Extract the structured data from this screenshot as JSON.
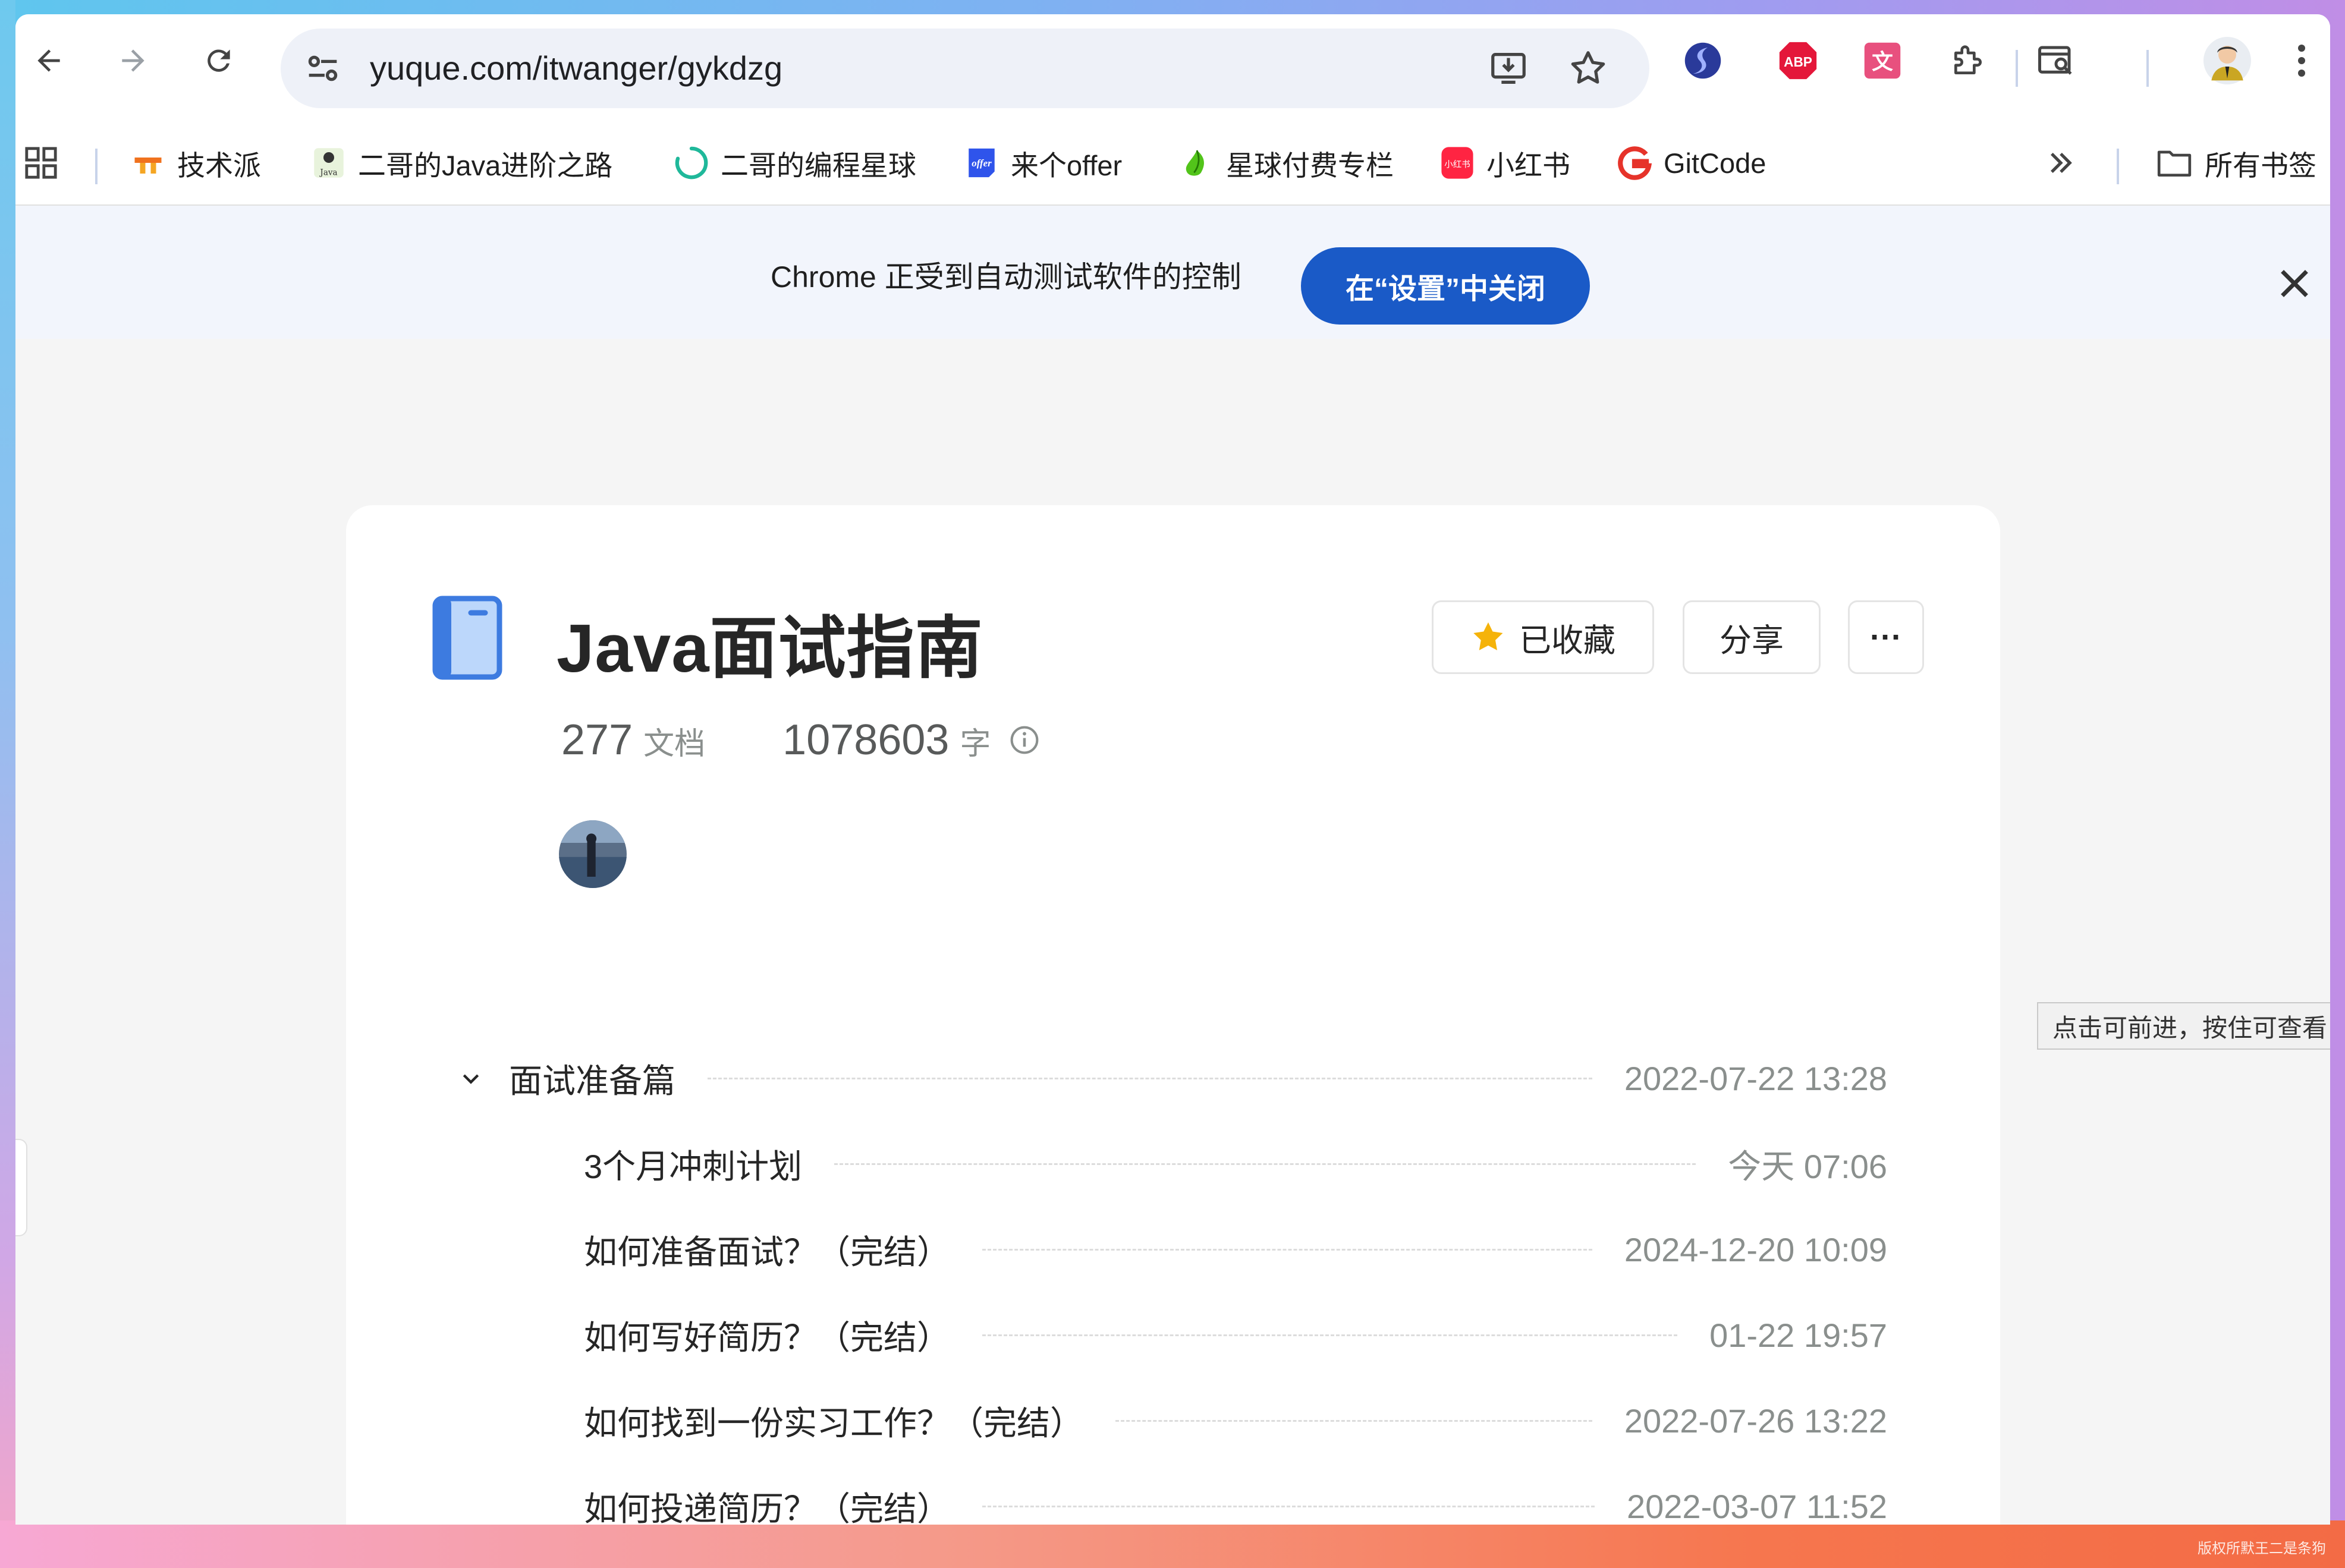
{
  "browser": {
    "url": "yuque.com/itwanger/gykdzg",
    "bookmarks": [
      {
        "label": "技术派",
        "icon": "jishupai-icon"
      },
      {
        "label": "二哥的Java进阶之路",
        "icon": "java-road-icon"
      },
      {
        "label": "二哥的编程星球",
        "icon": "planet-icon"
      },
      {
        "label": "来个offer",
        "icon": "offer-icon"
      },
      {
        "label": "星球付费专栏",
        "icon": "column-icon"
      },
      {
        "label": "小红书",
        "icon": "xiaohongshu-icon"
      },
      {
        "label": "GitCode",
        "icon": "gitcode-icon"
      }
    ],
    "all_bookmarks_label": "所有书签"
  },
  "infobar": {
    "text": "Chrome 正受到自动测试软件的控制",
    "button": "在“设置”中关闭"
  },
  "book": {
    "title": "Java面试指南",
    "doc_count": "277",
    "doc_unit": "文档",
    "word_count": "1078603",
    "word_unit": "字",
    "favorite_label": "已收藏",
    "share_label": "分享",
    "more_label": "···"
  },
  "toc": {
    "group": {
      "title": "面试准备篇",
      "date": "2022-07-22 13:28"
    },
    "items": [
      {
        "title": "3个月冲刺计划",
        "date": "今天 07:06"
      },
      {
        "title": "如何准备面试？（完结）",
        "date": "2024-12-20 10:09"
      },
      {
        "title": "如何写好简历？（完结）",
        "date": "01-22 19:57"
      },
      {
        "title": "如何找到一份实习工作？（完结）",
        "date": "2022-07-26 13:22"
      },
      {
        "title": "如何投递简历？（完结）",
        "date": "2022-03-07 11:52"
      }
    ]
  },
  "tooltip": "点击可前进，按住可查看",
  "watermark": "版权所默王二是条狗",
  "colors": {
    "accent_blue": "#1a5ac7",
    "star": "#f5b30a",
    "abp_red": "#e4173a"
  }
}
